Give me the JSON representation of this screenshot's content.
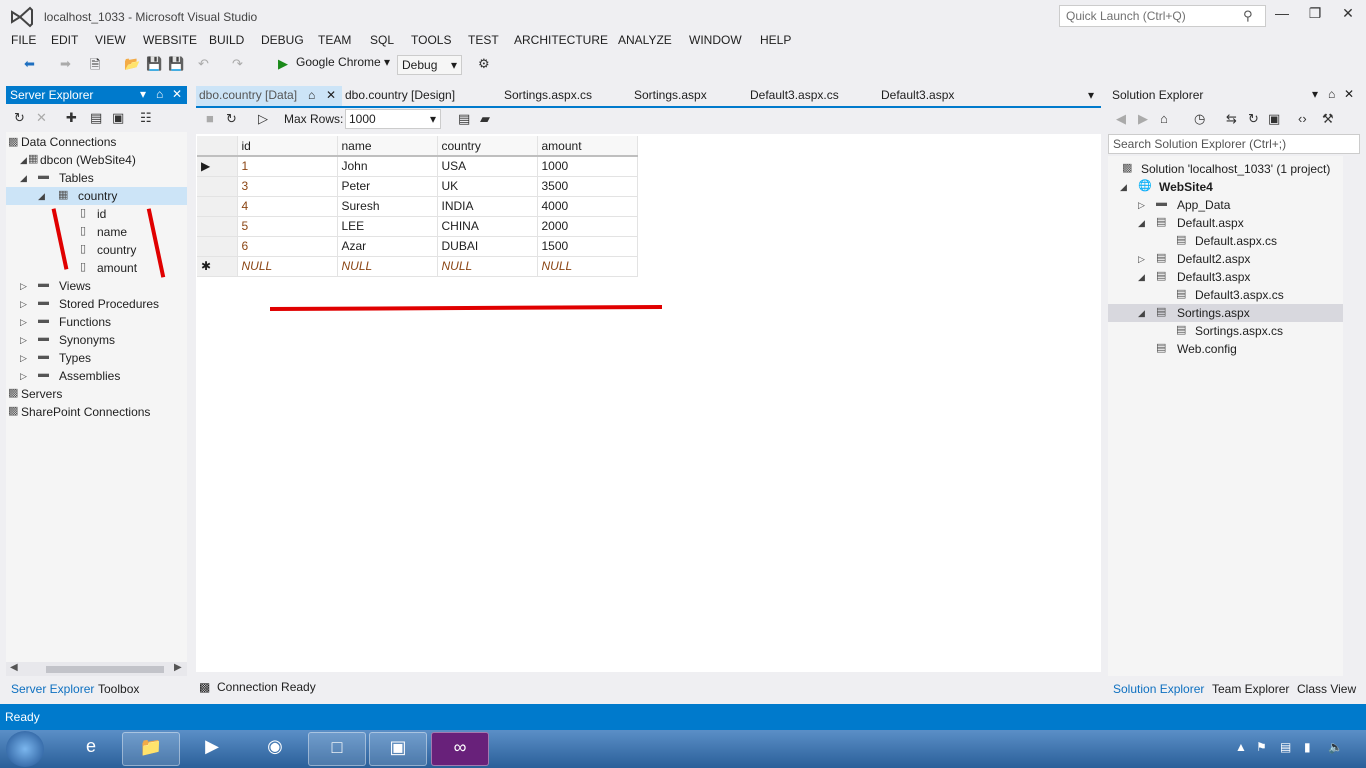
{
  "window": {
    "title": "localhost_1033 - Microsoft Visual Studio",
    "quick_launch_placeholder": "Quick Launch (Ctrl+Q)"
  },
  "menu": [
    "FILE",
    "EDIT",
    "VIEW",
    "WEBSITE",
    "BUILD",
    "DEBUG",
    "TEAM",
    "SQL",
    "TOOLS",
    "TEST",
    "ARCHITECTURE",
    "ANALYZE",
    "WINDOW",
    "HELP"
  ],
  "toolbar": {
    "run_target": "Google Chrome",
    "config": "Debug"
  },
  "server_explorer": {
    "title": "Server Explorer",
    "items": [
      "Data Connections",
      "dbcon (WebSite4)",
      "Tables",
      "country",
      "id",
      "name",
      "country",
      "amount",
      "Views",
      "Stored Procedures",
      "Functions",
      "Synonyms",
      "Types",
      "Assemblies",
      "Servers",
      "SharePoint Connections"
    ],
    "tabs": [
      "Server Explorer",
      "Toolbox"
    ]
  },
  "doc_tabs": [
    "dbo.country [Data]",
    "dbo.country [Design]",
    "Sortings.aspx.cs",
    "Sortings.aspx",
    "Default3.aspx.cs",
    "Default3.aspx"
  ],
  "doc_toolbar": {
    "max_rows_label": "Max Rows:",
    "max_rows_value": "1000"
  },
  "grid": {
    "columns": [
      "id",
      "name",
      "country",
      "amount"
    ],
    "rows": [
      [
        "1",
        "John",
        "USA",
        "1000"
      ],
      [
        "3",
        "Peter",
        "UK",
        "3500"
      ],
      [
        "4",
        "Suresh",
        "INDIA",
        "4000"
      ],
      [
        "5",
        "LEE",
        "CHINA",
        "2000"
      ],
      [
        "6",
        "Azar",
        "DUBAI",
        "1500"
      ],
      [
        "NULL",
        "NULL",
        "NULL",
        "NULL"
      ]
    ]
  },
  "doc_status": "Connection Ready",
  "solution_explorer": {
    "title": "Solution Explorer",
    "search_placeholder": "Search Solution Explorer (Ctrl+;)",
    "items": [
      "Solution 'localhost_1033' (1 project)",
      "WebSite4",
      "App_Data",
      "Default.aspx",
      "Default.aspx.cs",
      "Default2.aspx",
      "Default3.aspx",
      "Default3.aspx.cs",
      "Sortings.aspx",
      "Sortings.aspx.cs",
      "Web.config"
    ],
    "tabs": [
      "Solution Explorer",
      "Team Explorer",
      "Class View"
    ]
  },
  "status": "Ready",
  "accent": "#007acc"
}
